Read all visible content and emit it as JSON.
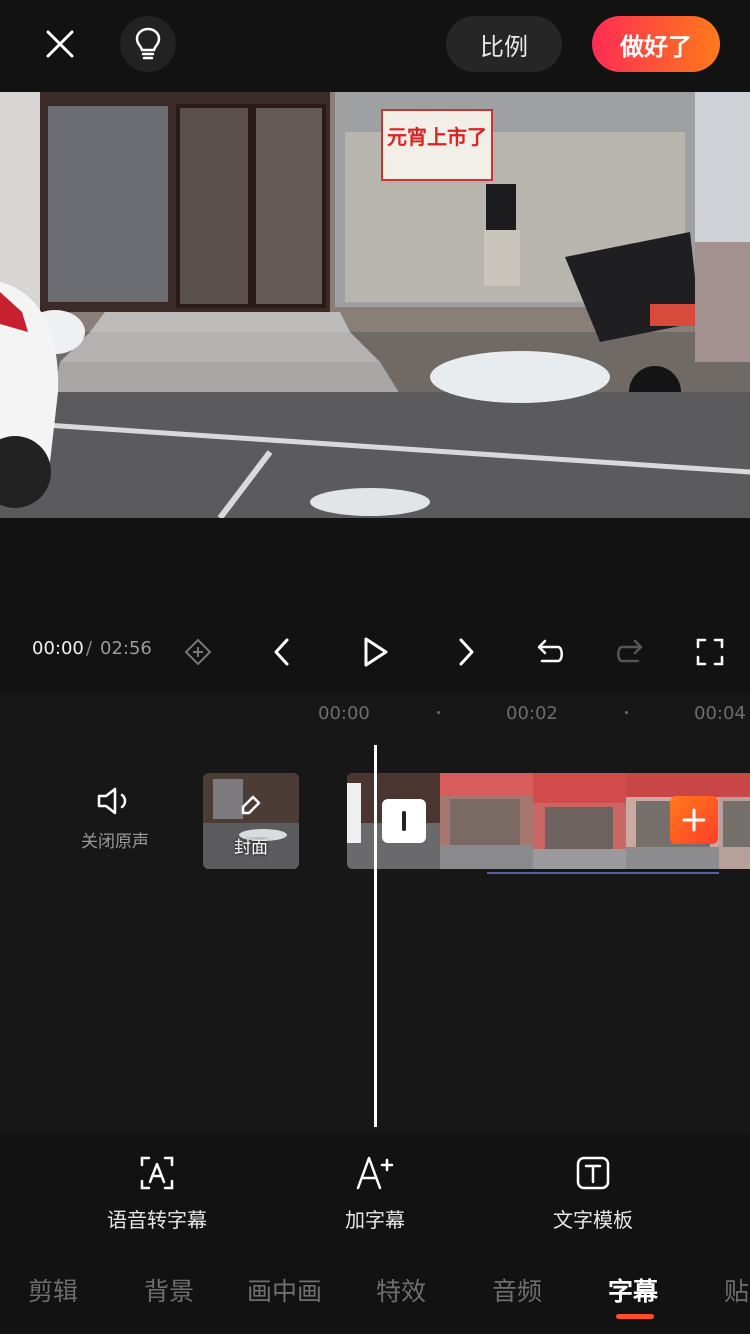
{
  "topbar": {
    "ratio_label": "比例",
    "done_label": "做好了"
  },
  "player": {
    "current_time": "00:00",
    "separator": "/",
    "total_time": "02:56"
  },
  "preview": {
    "sign_text": "元宵上市了"
  },
  "timeline": {
    "ruler": [
      "00:00",
      "00:02",
      "00:04"
    ],
    "mute_label": "关闭原声",
    "cover_label": "封面"
  },
  "tools": [
    {
      "label": "语音转字幕",
      "icon": "speech-to-text-icon"
    },
    {
      "label": "加字幕",
      "icon": "add-text-icon"
    },
    {
      "label": "文字模板",
      "icon": "text-template-icon"
    }
  ],
  "tabs": [
    "剪辑",
    "背景",
    "画中画",
    "特效",
    "音频",
    "字幕",
    "贴"
  ],
  "active_tab": "字幕",
  "colors": {
    "accent_start": "#ff2c55",
    "accent_end": "#ff7a1a",
    "background": "#121212"
  }
}
